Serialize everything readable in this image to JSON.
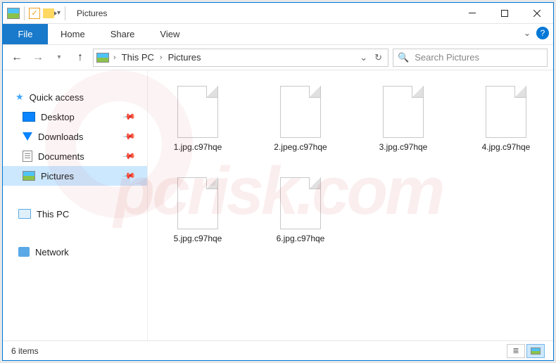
{
  "titlebar": {
    "title": "Pictures"
  },
  "ribbon": {
    "file": "File",
    "tabs": [
      "Home",
      "Share",
      "View"
    ]
  },
  "address": {
    "crumbs": [
      "This PC",
      "Pictures"
    ]
  },
  "search": {
    "placeholder": "Search Pictures"
  },
  "nav": {
    "quick_access": "Quick access",
    "items": [
      {
        "label": "Desktop",
        "pinned": true,
        "icon": "desktop"
      },
      {
        "label": "Downloads",
        "pinned": true,
        "icon": "down"
      },
      {
        "label": "Documents",
        "pinned": true,
        "icon": "doc"
      },
      {
        "label": "Pictures",
        "pinned": true,
        "icon": "pic",
        "selected": true
      }
    ],
    "this_pc": "This PC",
    "network": "Network"
  },
  "files": [
    {
      "name": "1.jpg.c97hqe"
    },
    {
      "name": "2.jpeg.c97hqe"
    },
    {
      "name": "3.jpg.c97hqe"
    },
    {
      "name": "4.jpg.c97hqe"
    },
    {
      "name": "5.jpg.c97hqe"
    },
    {
      "name": "6.jpg.c97hqe"
    }
  ],
  "status": {
    "count": "6 items"
  },
  "watermark": "pcrisk.com"
}
